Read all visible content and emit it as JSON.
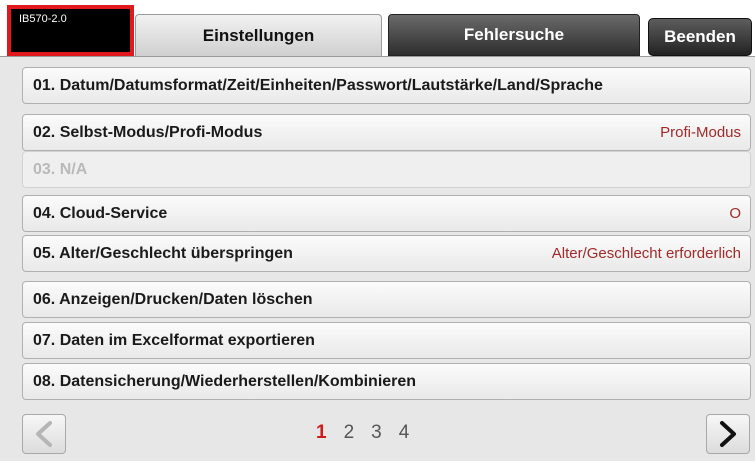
{
  "device": {
    "badge": "IB570-2.0"
  },
  "tabs": [
    {
      "label": "Einstellungen",
      "active": true
    },
    {
      "label": "Fehlersuche",
      "active": false
    }
  ],
  "exit_label": "Beenden",
  "menu": [
    {
      "label": "01. Datum/Datumsformat/Zeit/Einheiten/Passwort/Lautstärke/Land/Sprache",
      "value": ""
    },
    {
      "label": "02. Selbst-Modus/Profi-Modus",
      "value": "Profi-Modus"
    },
    {
      "label": "03. N/A",
      "value": "",
      "disabled": true
    },
    {
      "label": "04. Cloud-Service",
      "value": "O"
    },
    {
      "label": "05. Alter/Geschlecht überspringen",
      "value": "Alter/Geschlecht erforderlich"
    },
    {
      "label": "06. Anzeigen/Drucken/Daten löschen",
      "value": ""
    },
    {
      "label": "07. Daten im Excelformat exportieren",
      "value": ""
    },
    {
      "label": "08. Datensicherung/Wiederherstellen/Kombinieren",
      "value": ""
    }
  ],
  "pagination": {
    "pages": [
      "1",
      "2",
      "3",
      "4"
    ],
    "current": "1"
  },
  "colors": {
    "accent_red": "#e1191d",
    "value_red": "#a02a2a",
    "current_page": "#d11a1a"
  }
}
